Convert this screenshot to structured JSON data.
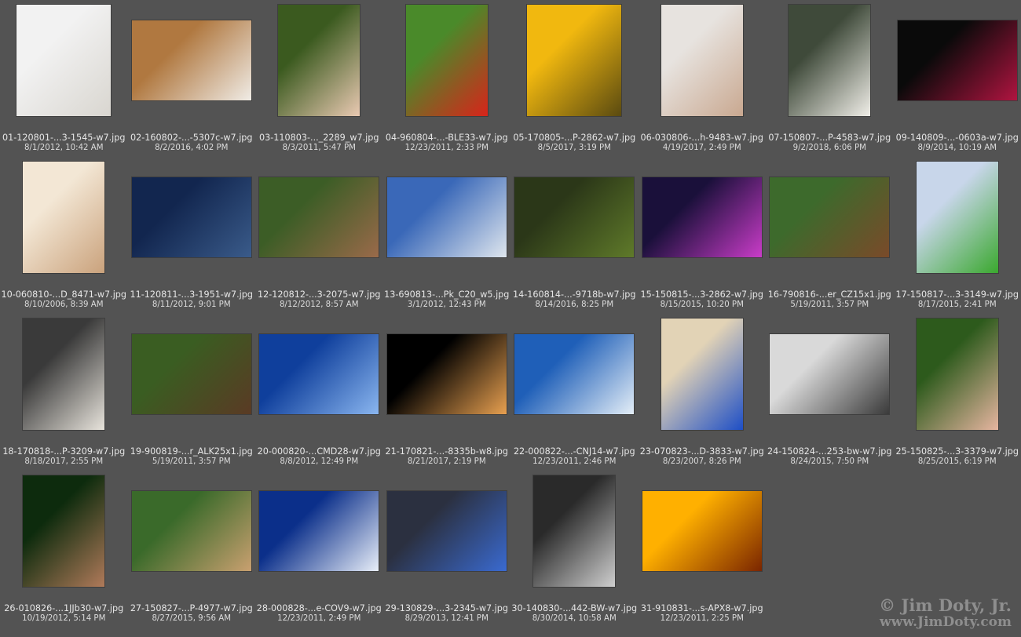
{
  "items": [
    {
      "filename": "01-120801-...3-1545-w7.jpg",
      "date": "8/1/2012, 10:42 AM",
      "orientation": "square",
      "colors": [
        "#f2f2f2",
        "#d9d6d0"
      ]
    },
    {
      "filename": "02-160802-...-5307c-w7.jpg",
      "date": "8/2/2016, 4:02 PM",
      "orientation": "landscape",
      "colors": [
        "#b07840",
        "#f0ece6"
      ]
    },
    {
      "filename": "03-110803-..._2289_w7.jpg",
      "date": "8/3/2011, 5:47 PM",
      "orientation": "portrait",
      "colors": [
        "#3b5a1f",
        "#e9c9b2"
      ]
    },
    {
      "filename": "04-960804-...-BLE33-w7.jpg",
      "date": "12/23/2011, 2:33 PM",
      "orientation": "portrait",
      "colors": [
        "#4a8a2a",
        "#d8241a"
      ]
    },
    {
      "filename": "05-170805-...P-2862-w7.jpg",
      "date": "8/5/2017, 3:19 PM",
      "orientation": "square",
      "colors": [
        "#f1b80f",
        "#5a4a10"
      ]
    },
    {
      "filename": "06-030806-...h-9483-w7.jpg",
      "date": "4/19/2017, 2:49 PM",
      "orientation": "portrait",
      "colors": [
        "#e7e3df",
        "#c9a890"
      ]
    },
    {
      "filename": "07-150807-...P-4583-w7.jpg",
      "date": "9/2/2018, 6:06 PM",
      "orientation": "portrait",
      "colors": [
        "#3f4a3a",
        "#f0eee8"
      ]
    },
    {
      "filename": "09-140809-...-0603a-w7.jpg",
      "date": "8/9/2014, 10:19 AM",
      "orientation": "landscape",
      "colors": [
        "#0a0a0a",
        "#b01440"
      ]
    },
    {
      "filename": "10-060810-...D_8471-w7.jpg",
      "date": "8/10/2006, 8:39 AM",
      "orientation": "portrait",
      "colors": [
        "#f3e7d5",
        "#caa27c"
      ]
    },
    {
      "filename": "11-120811-...3-1951-w7.jpg",
      "date": "8/11/2012, 9:01 PM",
      "orientation": "landscape",
      "colors": [
        "#12264f",
        "#3a5b8a"
      ]
    },
    {
      "filename": "12-120812-...3-2075-w7.jpg",
      "date": "8/12/2012, 8:57 AM",
      "orientation": "landscape",
      "colors": [
        "#3c5d26",
        "#9a6a4a"
      ]
    },
    {
      "filename": "13-690813-...Pk_C20_w5.jpg",
      "date": "3/1/2012, 12:43 PM",
      "orientation": "landscape",
      "colors": [
        "#3a68b8",
        "#dfe6ee"
      ]
    },
    {
      "filename": "14-160814-...-9718b-w7.jpg",
      "date": "8/14/2016, 8:25 PM",
      "orientation": "landscape",
      "colors": [
        "#2b3718",
        "#5f7a2a"
      ]
    },
    {
      "filename": "15-150815-...3-2862-w7.jpg",
      "date": "8/15/2015, 10:20 PM",
      "orientation": "landscape",
      "colors": [
        "#1a103a",
        "#c93cc8"
      ]
    },
    {
      "filename": "16-790816-...er_CZ15x1.jpg",
      "date": "5/19/2011, 3:57 PM",
      "orientation": "landscape",
      "colors": [
        "#3d6a2c",
        "#7a4a2a"
      ]
    },
    {
      "filename": "17-150817-...3-3149-w7.jpg",
      "date": "8/17/2015, 2:41 PM",
      "orientation": "portrait",
      "colors": [
        "#c8d6ea",
        "#3aa82e"
      ]
    },
    {
      "filename": "18-170818-...P-3209-w7.jpg",
      "date": "8/18/2017, 2:55 PM",
      "orientation": "portrait",
      "colors": [
        "#3a3a3a",
        "#e8e4dc"
      ]
    },
    {
      "filename": "19-900819-...r_ALK25x1.jpg",
      "date": "5/19/2011, 3:57 PM",
      "orientation": "landscape",
      "colors": [
        "#3a5d22",
        "#5a3a24"
      ]
    },
    {
      "filename": "20-000820-...CMD28-w7.jpg",
      "date": "8/8/2012, 12:49 PM",
      "orientation": "landscape",
      "colors": [
        "#0f3f9c",
        "#8ab6ef"
      ]
    },
    {
      "filename": "21-170821-...-8335b-w8.jpg",
      "date": "8/21/2017, 2:19 PM",
      "orientation": "landscape",
      "colors": [
        "#000000",
        "#e8a050"
      ]
    },
    {
      "filename": "22-000822-...-CNJ14-w7.jpg",
      "date": "12/23/2011, 2:46 PM",
      "orientation": "landscape",
      "colors": [
        "#1f5fb8",
        "#e4eef7"
      ]
    },
    {
      "filename": "23-070823-...D-3833-w7.jpg",
      "date": "8/23/2007, 8:26 PM",
      "orientation": "portrait",
      "colors": [
        "#e2d3b6",
        "#1d4ec6"
      ]
    },
    {
      "filename": "24-150824-...253-bw-w7.jpg",
      "date": "8/24/2015, 7:50 PM",
      "orientation": "landscape",
      "colors": [
        "#d9d9d9",
        "#3a3a3a"
      ]
    },
    {
      "filename": "25-150825-...3-3379-w7.jpg",
      "date": "8/25/2015, 6:19 PM",
      "orientation": "portrait",
      "colors": [
        "#2d5a1c",
        "#e6b5a0"
      ]
    },
    {
      "filename": "26-010826-...1JJb30-w7.jpg",
      "date": "10/19/2012, 5:14 PM",
      "orientation": "portrait",
      "colors": [
        "#0d2b0d",
        "#b07a5a"
      ]
    },
    {
      "filename": "27-150827-...P-4977-w7.jpg",
      "date": "8/27/2015, 9:56 AM",
      "orientation": "landscape",
      "colors": [
        "#3a6a2a",
        "#c9a070"
      ]
    },
    {
      "filename": "28-000828-...e-COV9-w7.jpg",
      "date": "12/23/2011, 2:49 PM",
      "orientation": "landscape",
      "colors": [
        "#0b2f8a",
        "#e8eef8"
      ]
    },
    {
      "filename": "29-130829-...3-2345-w7.jpg",
      "date": "8/29/2013, 12:41 PM",
      "orientation": "landscape",
      "colors": [
        "#2b3040",
        "#3a6ad0"
      ]
    },
    {
      "filename": "30-140830-...442-BW-w7.jpg",
      "date": "8/30/2014, 10:58 AM",
      "orientation": "portrait",
      "colors": [
        "#2a2a2a",
        "#cfcfcf"
      ]
    },
    {
      "filename": "31-910831-...s-APX8-w7.jpg",
      "date": "12/23/2011, 2:25 PM",
      "orientation": "landscape",
      "colors": [
        "#ffb000",
        "#7a2500"
      ]
    }
  ],
  "watermark": {
    "line1": "© Jim Doty, Jr.",
    "line2": "www.JimDoty.com"
  }
}
